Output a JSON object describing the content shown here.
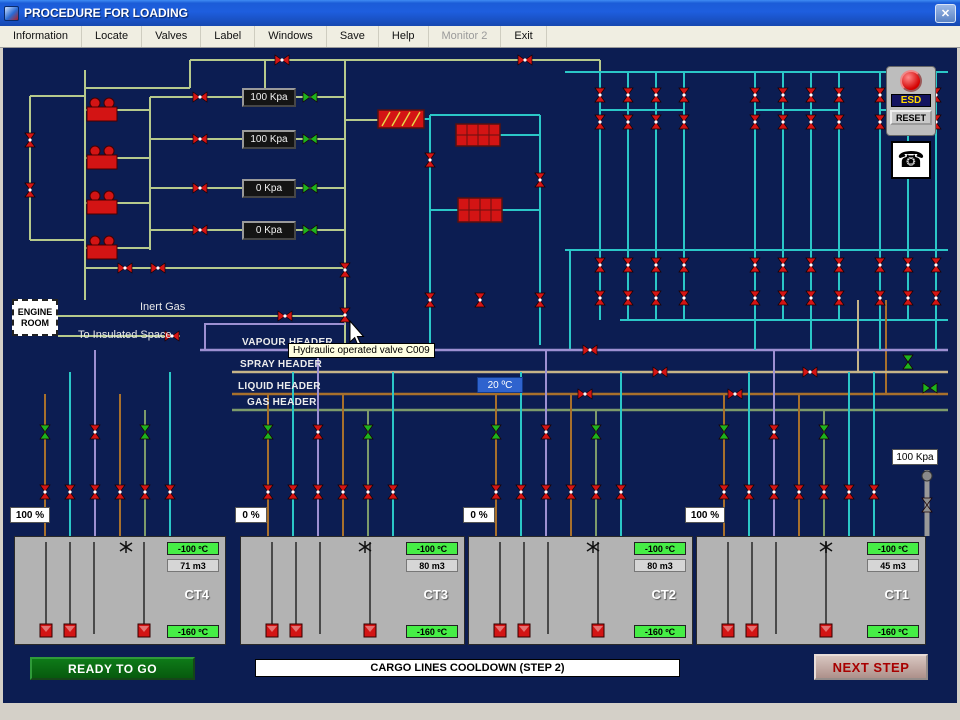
{
  "window": {
    "title": "PROCEDURE FOR LOADING"
  },
  "icons": {
    "close": "✕",
    "phone": "☎"
  },
  "menu": {
    "items": [
      {
        "label": "Information",
        "enabled": true
      },
      {
        "label": "Locate",
        "enabled": true
      },
      {
        "label": "Valves",
        "enabled": true
      },
      {
        "label": "Label",
        "enabled": true
      },
      {
        "label": "Windows",
        "enabled": true
      },
      {
        "label": "Save",
        "enabled": true
      },
      {
        "label": "Help",
        "enabled": true
      },
      {
        "label": "Monitor 2",
        "enabled": false
      },
      {
        "label": "Exit",
        "enabled": true
      }
    ]
  },
  "esd": {
    "esd_label": "ESD",
    "reset_label": "RESET"
  },
  "pressures": {
    "top_boxes": [
      "100 Kpa",
      "100 Kpa",
      "0 Kpa",
      "0 Kpa"
    ],
    "right_badge": "100 Kpa"
  },
  "labels": {
    "engine_room": "ENGINE ROOM",
    "inert_gas": "Inert Gas",
    "to_insulated": "To Insulated Space",
    "vapour_header": "VAPOUR HEADER",
    "spray_header": "SPRAY HEADER",
    "liquid_header": "LIQUID HEADER",
    "gas_header": "GAS HEADER"
  },
  "tooltip": {
    "text": "Hydraulic operated valve  C009"
  },
  "temperature_badge": "20 ºC",
  "percent_badges": [
    "100 %",
    "0 %",
    "0 %",
    "100 %"
  ],
  "tanks": [
    {
      "name": "CT4",
      "top_temp": "-100 ºC",
      "volume": "71 m3",
      "bottom_temp": "-160 ºC"
    },
    {
      "name": "CT3",
      "top_temp": "-100 ºC",
      "volume": "80 m3",
      "bottom_temp": "-160 ºC"
    },
    {
      "name": "CT2",
      "top_temp": "-100 ºC",
      "volume": "80 m3",
      "bottom_temp": "-160 ºC"
    },
    {
      "name": "CT1",
      "top_temp": "-100 ºC",
      "volume": "45 m3",
      "bottom_temp": "-160 ºC"
    }
  ],
  "footer": {
    "ready": "READY TO GO",
    "status": "CARGO LINES COOLDOWN (STEP 2)",
    "next": "NEXT STEP"
  },
  "colors": {
    "canvas_navy": "#0c1d52",
    "badge_green": "#46ee46",
    "valve_red": "#d31414",
    "valve_green": "#1db31d",
    "ready_green": "#0a6a12"
  }
}
